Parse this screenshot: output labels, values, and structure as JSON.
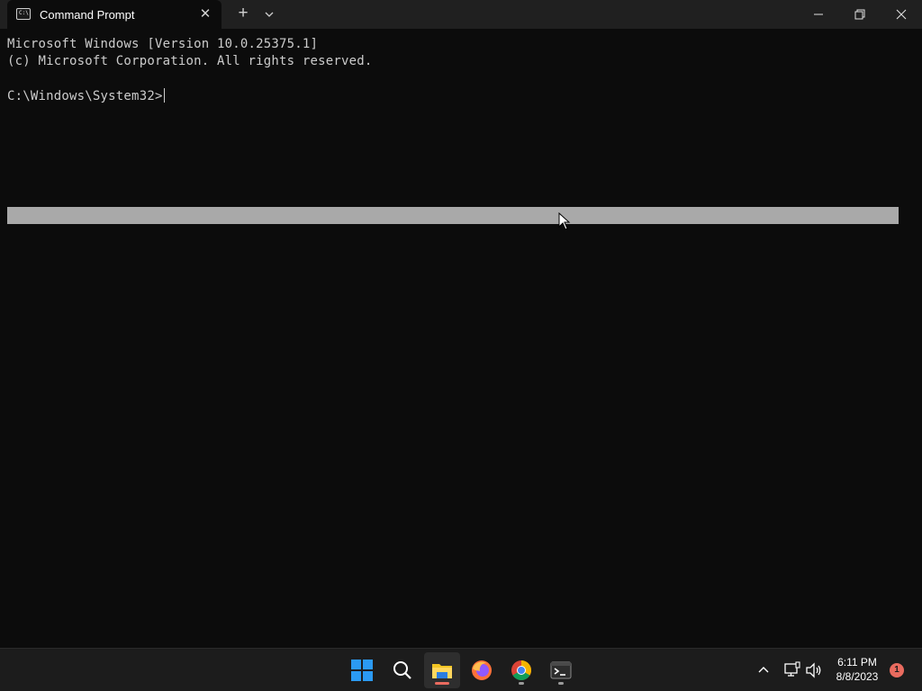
{
  "window": {
    "tab_title": "Command Prompt",
    "tab_icon": "cmd-icon",
    "new_tab_symbol": "+",
    "close_tab_symbol": "✕"
  },
  "console": {
    "lines": [
      "Microsoft Windows [Version 10.0.25375.1]",
      "(c) Microsoft Corporation. All rights reserved.",
      "C:\\Windows\\System32>"
    ]
  },
  "taskbar": {
    "apps": [
      "start-icon",
      "search-icon",
      "file-explorer-icon",
      "firefox-icon",
      "chrome-icon",
      "terminal-icon"
    ],
    "clock": {
      "time": "6:11 PM",
      "date": "8/8/2023"
    },
    "notification_count": "1"
  },
  "colors": {
    "background": "#0c0c0c",
    "titlebar": "#202020",
    "text": "#cccccc",
    "selection_bar": "#a9a9a9",
    "taskbar": "#1c1c1c",
    "accent": "#e96b5f"
  }
}
